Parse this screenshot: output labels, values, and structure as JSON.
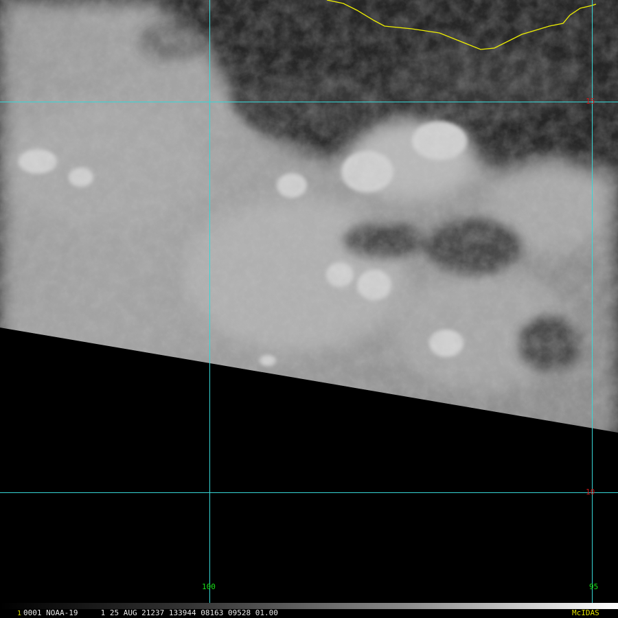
{
  "image": {
    "frame_number": "1",
    "status_line": "0001 NOAA-19     1 25 AUG 21237 133944 08163 09528 01.00",
    "brand": "McIDAS"
  },
  "grid": {
    "color": "#37d7d7",
    "latitude_labels": [
      "15",
      "10"
    ],
    "longitude_labels": [
      "100",
      "95"
    ]
  },
  "colors": {
    "coastline": "#f0f000",
    "lat_label": "#d01818",
    "lon_label": "#18e018"
  }
}
